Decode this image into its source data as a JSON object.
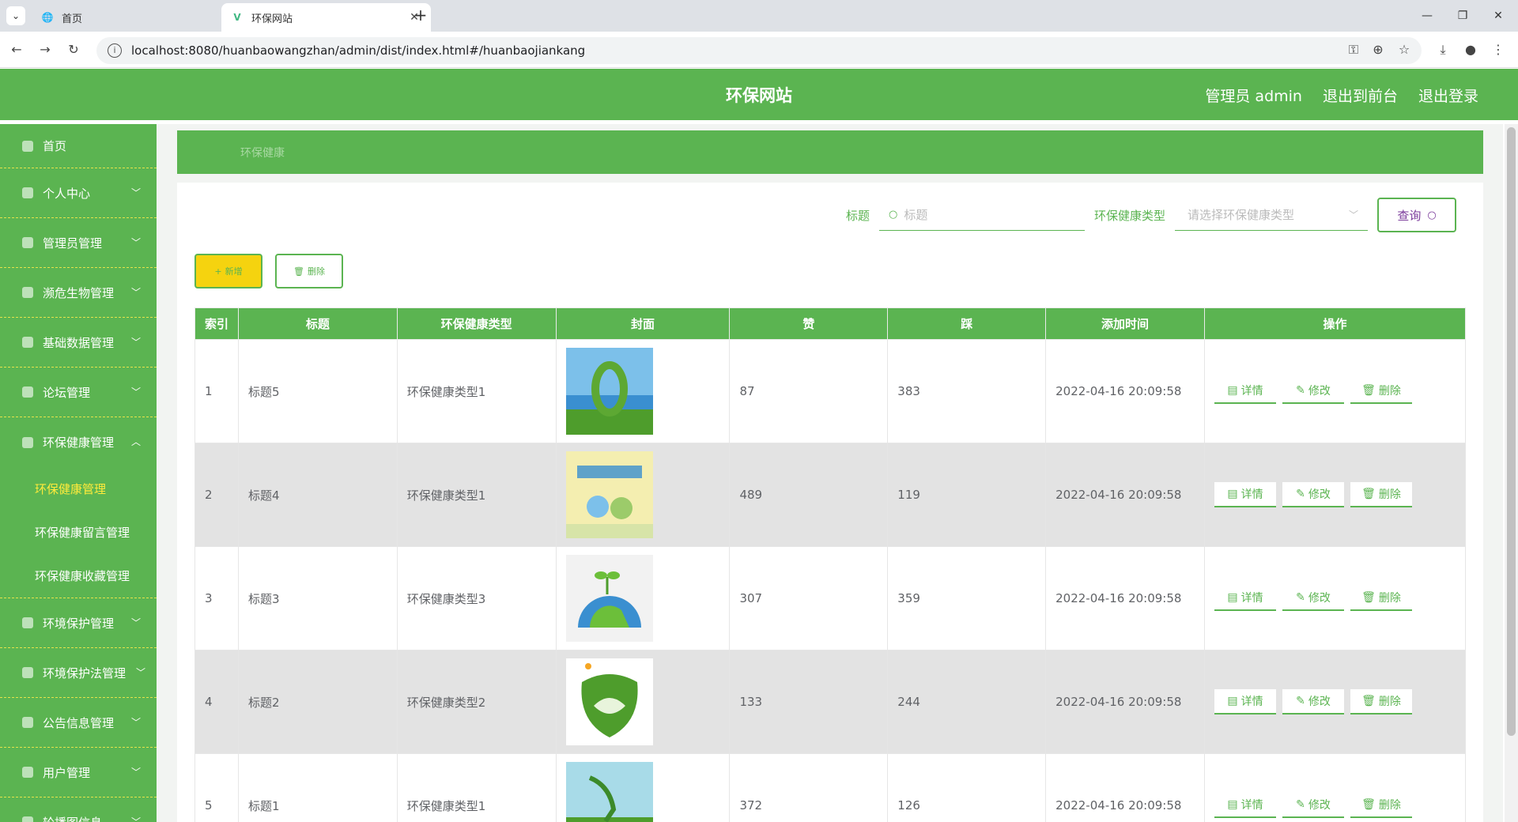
{
  "browser": {
    "tabs": [
      {
        "title": "首页",
        "active": false
      },
      {
        "title": "环保网站",
        "active": true
      }
    ],
    "url": "localhost:8080/huanbaowangzhan/admin/dist/index.html#/huanbaojiankang"
  },
  "header": {
    "title": "环保网站",
    "user": "管理员 admin",
    "to_front": "退出到前台",
    "logout": "退出登录"
  },
  "sidebar": {
    "items": [
      {
        "label": "首页"
      },
      {
        "label": "个人中心"
      },
      {
        "label": "管理员管理"
      },
      {
        "label": "濒危生物管理"
      },
      {
        "label": "基础数据管理"
      },
      {
        "label": "论坛管理"
      },
      {
        "label": "环保健康管理"
      },
      {
        "label": "环境保护管理"
      },
      {
        "label": "环境保护法管理"
      },
      {
        "label": "公告信息管理"
      },
      {
        "label": "用户管理"
      },
      {
        "label": "轮播图信息"
      }
    ],
    "submenu": [
      {
        "label": "环保健康管理"
      },
      {
        "label": "环保健康留言管理"
      },
      {
        "label": "环保健康收藏管理"
      }
    ]
  },
  "breadcrumb": "环保健康",
  "search": {
    "title_label": "标题",
    "title_placeholder": "标题",
    "type_label": "环保健康类型",
    "type_placeholder": "请选择环保健康类型",
    "query": "查询"
  },
  "actions": {
    "add": "新增",
    "delete": "删除"
  },
  "table": {
    "headers": [
      "索引",
      "标题",
      "环保健康类型",
      "封面",
      "赞",
      "踩",
      "添加时间",
      "操作"
    ],
    "rows": [
      {
        "index": "1",
        "title": "标题5",
        "type": "环保健康类型1",
        "likes": "87",
        "dislikes": "383",
        "time": "2022-04-16 20:09:58"
      },
      {
        "index": "2",
        "title": "标题4",
        "type": "环保健康类型1",
        "likes": "489",
        "dislikes": "119",
        "time": "2022-04-16 20:09:58"
      },
      {
        "index": "3",
        "title": "标题3",
        "type": "环保健康类型3",
        "likes": "307",
        "dislikes": "359",
        "time": "2022-04-16 20:09:58"
      },
      {
        "index": "4",
        "title": "标题2",
        "type": "环保健康类型2",
        "likes": "133",
        "dislikes": "244",
        "time": "2022-04-16 20:09:58"
      },
      {
        "index": "5",
        "title": "标题1",
        "type": "环保健康类型1",
        "likes": "372",
        "dislikes": "126",
        "time": "2022-04-16 20:09:58"
      }
    ],
    "ops": {
      "detail": "详情",
      "edit": "修改",
      "delete": "删除"
    }
  },
  "colors": {
    "primary": "#5bb451",
    "accent": "#f5d30f",
    "active_text": "#ffeb3b"
  }
}
